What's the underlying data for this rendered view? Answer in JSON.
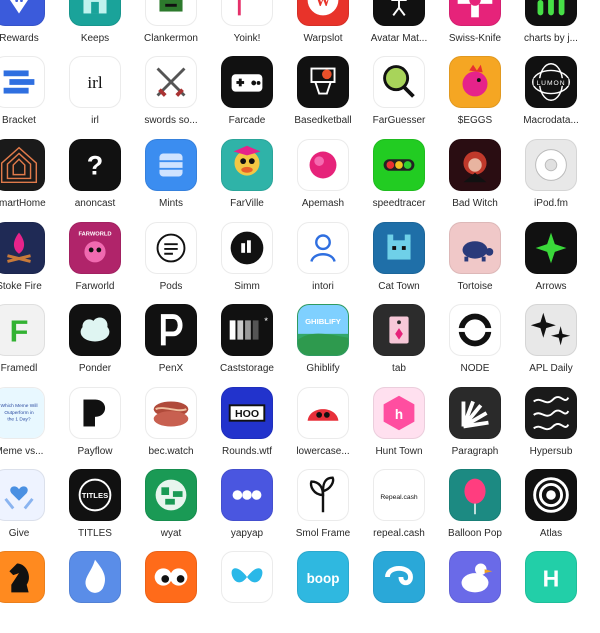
{
  "screen": {
    "title": "",
    "background": "#ffffff"
  },
  "rows": [
    {
      "apps": [
        {
          "label": "Rewards",
          "icon": "reward-badge-icon",
          "bg": "#3b5bdb"
        },
        {
          "label": "Keeps",
          "icon": "castle-icon",
          "bg": "#1aa39a"
        },
        {
          "label": "Clankermon",
          "icon": "pixel-creature-icon",
          "bg": "#ffffff"
        },
        {
          "label": "Yoink!",
          "icon": "flag-icon",
          "bg": "#ffffff"
        },
        {
          "label": "Warpslot",
          "icon": "warp-logo-icon",
          "bg": "#e8332a"
        },
        {
          "label": "Avatar Mat...",
          "icon": "stick-figure-icon",
          "bg": "#111111"
        },
        {
          "label": "Swiss-Knife",
          "icon": "swiss-knife-icon",
          "bg": "#e6237a"
        },
        {
          "label": "charts by j...",
          "icon": "bar-chart-icon",
          "bg": "#111111"
        }
      ]
    },
    {
      "apps": [
        {
          "label": "Bracket",
          "icon": "bracket-icon",
          "bg": "#ffffff"
        },
        {
          "label": "irl",
          "icon": "irl-text-icon",
          "bg": "#ffffff"
        },
        {
          "label": "swords so...",
          "icon": "crossed-swords-icon",
          "bg": "#ffffff"
        },
        {
          "label": "Farcade",
          "icon": "gamepad-icon",
          "bg": "#111111"
        },
        {
          "label": "Basedketball",
          "icon": "basketball-hoop-icon",
          "bg": "#111111"
        },
        {
          "label": "FarGuesser",
          "icon": "magnifier-map-icon",
          "bg": "#ffffff"
        },
        {
          "label": "$EGGS",
          "icon": "rooster-icon",
          "bg": "#f5a623"
        },
        {
          "label": "Macrodata...",
          "icon": "lumon-logo-icon",
          "bg": "#111111"
        }
      ]
    },
    {
      "apps": [
        {
          "label": "SmartHome",
          "icon": "house-outline-icon",
          "bg": "#1a1a1a"
        },
        {
          "label": "anoncast",
          "icon": "question-mark-icon",
          "bg": "#111111"
        },
        {
          "label": "Mints",
          "icon": "stack-icon",
          "bg": "#3b8df0"
        },
        {
          "label": "FarVille",
          "icon": "cartoon-duck-icon",
          "bg": "#2fb3a8"
        },
        {
          "label": "Apemash",
          "icon": "pink-orb-icon",
          "bg": "#ffffff"
        },
        {
          "label": "speedtracer",
          "icon": "traffic-light-icon",
          "bg": "#22cc22"
        },
        {
          "label": "Bad Witch",
          "icon": "witch-portrait-icon",
          "bg": "#2a0d12"
        },
        {
          "label": "iPod.fm",
          "icon": "ipod-wheel-icon",
          "bg": "#e8e8e8"
        }
      ]
    },
    {
      "apps": [
        {
          "label": "Stoke Fire",
          "icon": "campfire-icon",
          "bg": "#1f2a55"
        },
        {
          "label": "Farworld",
          "icon": "pink-monster-icon",
          "bg": "#b0246a"
        },
        {
          "label": "Pods",
          "icon": "menu-circle-icon",
          "bg": "#ffffff"
        },
        {
          "label": "Simm",
          "icon": "simm-logo-icon",
          "bg": "#ffffff"
        },
        {
          "label": "intori",
          "icon": "person-outline-icon",
          "bg": "#ffffff"
        },
        {
          "label": "Cat Town",
          "icon": "pixel-cat-icon",
          "bg": "#1f6fa8"
        },
        {
          "label": "Tortoise",
          "icon": "tortoise-icon",
          "bg": "#f0c8c8"
        },
        {
          "label": "Arrows",
          "icon": "arrows-burst-icon",
          "bg": "#111111"
        }
      ]
    },
    {
      "apps": [
        {
          "label": "Framedl",
          "icon": "letter-f-grid-icon",
          "bg": "#f2f2f2"
        },
        {
          "label": "Ponder",
          "icon": "cloud-icon",
          "bg": "#111111"
        },
        {
          "label": "PenX",
          "icon": "letter-p-icon",
          "bg": "#111111"
        },
        {
          "label": "Caststorage",
          "icon": "gradient-bars-icon",
          "bg": "#111111"
        },
        {
          "label": "Ghiblify",
          "icon": "ghiblify-landscape-icon",
          "bg": "#33a86a"
        },
        {
          "label": "tab",
          "icon": "tab-tag-icon",
          "bg": "#2c2c2c"
        },
        {
          "label": "NODE",
          "icon": "ring-node-icon",
          "bg": "#ffffff"
        },
        {
          "label": "APL Daily",
          "icon": "sparkle-stars-icon",
          "bg": "#e8e8e8"
        }
      ]
    },
    {
      "apps": [
        {
          "label": "Meme vs...",
          "icon": "meme-text-icon",
          "bg": "#ffffff"
        },
        {
          "label": "Payflow",
          "icon": "payflow-logo-icon",
          "bg": "#ffffff"
        },
        {
          "label": "bec.watch",
          "icon": "bacon-icon",
          "bg": "#ffffff"
        },
        {
          "label": "Rounds.wtf",
          "icon": "rounds-logo-icon",
          "bg": "#2233cc"
        },
        {
          "label": "lowercase...",
          "icon": "red-blob-icon",
          "bg": "#ffffff"
        },
        {
          "label": "Hunt Town",
          "icon": "hunt-town-hex-icon",
          "bg": "#ffe0ef"
        },
        {
          "label": "Paragraph",
          "icon": "paragraph-rays-icon",
          "bg": "#2a2a2a"
        },
        {
          "label": "Hypersub",
          "icon": "scribble-pattern-icon",
          "bg": "#1a1a1a"
        }
      ]
    },
    {
      "apps": [
        {
          "label": "Give",
          "icon": "heart-hands-icon",
          "bg": "#eef3ff"
        },
        {
          "label": "TITLES",
          "icon": "titles-swirl-icon",
          "bg": "#111111"
        },
        {
          "label": "wyat",
          "icon": "pixel-globe-icon",
          "bg": "#1a9a55"
        },
        {
          "label": "yapyap",
          "icon": "three-dots-icon",
          "bg": "#4a56e0"
        },
        {
          "label": "Smol Frame",
          "icon": "sprout-icon",
          "bg": "#ffffff"
        },
        {
          "label": "repeal.cash",
          "icon": "repeal-logo-icon",
          "bg": "#ffffff"
        },
        {
          "label": "Balloon Pop",
          "icon": "balloon-icon",
          "bg": "#1c8a82"
        },
        {
          "label": "Atlas",
          "icon": "concentric-circles-icon",
          "bg": "#111111"
        }
      ]
    },
    {
      "apps": [
        {
          "label": "",
          "icon": "chess-knight-icon",
          "bg": "#ff8a1f"
        },
        {
          "label": "",
          "icon": "flame-icon",
          "bg": "#5a8de8"
        },
        {
          "label": "",
          "icon": "googly-eyes-icon",
          "bg": "#ff6b1a"
        },
        {
          "label": "",
          "icon": "butterfly-icon",
          "bg": "#ffffff"
        },
        {
          "label": "",
          "icon": "boop-logo-icon",
          "bg": "#2fb8e0"
        },
        {
          "label": "",
          "icon": "swirl-logo-icon",
          "bg": "#2aa8d8"
        },
        {
          "label": "",
          "icon": "goose-icon",
          "bg": "#6a6ae8"
        },
        {
          "label": "",
          "icon": "letter-h-icon",
          "bg": "#22cfa8"
        }
      ]
    }
  ],
  "icon_text": {
    "irl": "irl",
    "question": "?",
    "boop": "boop",
    "ghiblify": "GHIBLIFY",
    "lumon": "LUMON",
    "titles": "TITLES",
    "meme": "Which Meme Will Outperform in the 1 Day?",
    "farworld": "FARWORLD",
    "rounds": "HOO",
    "repeal": "Repeal.cash",
    "h": "h",
    "w": "W",
    "f": "F"
  }
}
